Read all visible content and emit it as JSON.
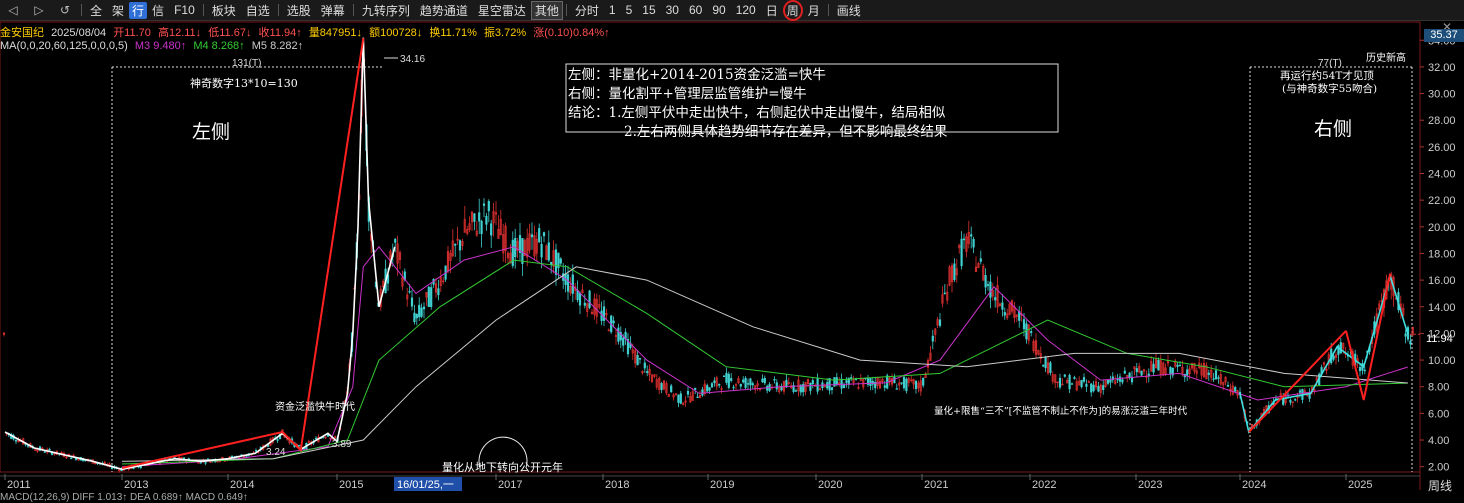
{
  "toolbar": {
    "items": [
      "全",
      "架",
      "行",
      "信",
      "F10",
      "板块",
      "自选",
      "选股",
      "弹幕",
      "九转序列",
      "趋势通道",
      "星空雷达",
      "其他",
      "分时",
      "1",
      "5",
      "15",
      "30",
      "60",
      "90",
      "120",
      "日",
      "周",
      "月",
      "画线"
    ]
  },
  "info": {
    "name": "金安国纪",
    "date": "2025/08/04",
    "open": "开11.70",
    "high": "高12.11↓",
    "low": "低11.67↓",
    "close": "收11.94↑",
    "vol": "量847951↓",
    "amount": "额100728↓",
    "turnover": "换11.71%",
    "amplitude": "振3.72%",
    "change": "涨(0.10)0.84%↑"
  },
  "ma": {
    "params": "MA(0,0,20,60,125,0,0,0,5)",
    "m3": "M3 9.480↑",
    "m4": "M4 8.268↑",
    "m5": "M5 8.282↑"
  },
  "badges": {
    "top": "35.37",
    "last": "11.94",
    "period": "周线"
  },
  "macd": "MACD(12,26,9)  DIFF 1.013↑  DEA 0.689↑  MACD 0.649↑",
  "annotations": {
    "box_line1": "左侧：非量化+2014-2015资金泛滥=快牛",
    "box_line2": "右侧：量化割平+管理层监管维护=慢牛",
    "box_line3": "结论：1.左侧平伏中走出快牛，右侧起伏中走出慢牛，结局相似",
    "box_line4": "2.左右两侧具体趋势细节存在差异，但不影响最终结果",
    "left_count": "131(T)",
    "left_magic": "神奇数字13*10=130",
    "left_label": "左侧",
    "right_count": "77(T)",
    "right_hist": "历史新高",
    "right_note1": "再运行约54T才见顶",
    "right_note2": "(与神奇数字55吻合)",
    "right_label": "右侧",
    "fund_note": "资金泛滥快牛时代",
    "quant_note": "量化从地下转向公开元年",
    "bottom_note": "量化+限售“三不”[不监管不制止不作为]的易涨泛滥三年时代",
    "cursor_date": "16/01/25,一",
    "peak": "34.16",
    "low1": "3.24",
    "low2": "3.89"
  },
  "chart_data": {
    "type": "candlestick",
    "title": "",
    "yticks": [
      2,
      4,
      6,
      8,
      10,
      12,
      14,
      16,
      18,
      20,
      22,
      24,
      26,
      28,
      30,
      32,
      34
    ],
    "ylim": [
      1.6,
      35.37
    ],
    "xticks": [
      "2011",
      "2013",
      "2014",
      "2015",
      "2017",
      "2018",
      "2019",
      "2020",
      "2021",
      "2022",
      "2023",
      "2024",
      "2025"
    ],
    "series": [
      {
        "name": "close",
        "points": [
          [
            "2011-01",
            4.6
          ],
          [
            "2011-07",
            3.4
          ],
          [
            "2012-01",
            2.9
          ],
          [
            "2012-07",
            2.4
          ],
          [
            "2013-01",
            1.8
          ],
          [
            "2013-04",
            2.2
          ],
          [
            "2013-07",
            2.6
          ],
          [
            "2013-10",
            2.4
          ],
          [
            "2014-01",
            2.6
          ],
          [
            "2014-04",
            3.0
          ],
          [
            "2014-07",
            4.5
          ],
          [
            "2014-09",
            3.3
          ],
          [
            "2014-12",
            4.5
          ],
          [
            "2015-01",
            3.9
          ],
          [
            "2015-03",
            7.5
          ],
          [
            "2015-04",
            12.0
          ],
          [
            "2015-05",
            20.0
          ],
          [
            "2015-06",
            34.2
          ],
          [
            "2015-07",
            22.0
          ],
          [
            "2015-09",
            14.0
          ],
          [
            "2015-12",
            18.5
          ],
          [
            "2016-03",
            13.0
          ],
          [
            "2016-06",
            16.0
          ],
          [
            "2016-09",
            19.5
          ],
          [
            "2016-12",
            21.0
          ],
          [
            "2017-03",
            18.0
          ],
          [
            "2017-06",
            19.0
          ],
          [
            "2017-09",
            16.0
          ],
          [
            "2017-12",
            14.0
          ],
          [
            "2018-03",
            12.0
          ],
          [
            "2018-06",
            9.0
          ],
          [
            "2018-10",
            7.0
          ],
          [
            "2019-03",
            8.5
          ],
          [
            "2019-09",
            8.0
          ],
          [
            "2020-03",
            8.2
          ],
          [
            "2020-09",
            8.4
          ],
          [
            "2021-01",
            8.0
          ],
          [
            "2021-04",
            16.0
          ],
          [
            "2021-06",
            19.0
          ],
          [
            "2021-09",
            15.0
          ],
          [
            "2021-12",
            13.0
          ],
          [
            "2022-04",
            8.5
          ],
          [
            "2022-09",
            8.0
          ],
          [
            "2023-03",
            9.5
          ],
          [
            "2023-09",
            9.2
          ],
          [
            "2024-01",
            7.5
          ],
          [
            "2024-02",
            4.6
          ],
          [
            "2024-05",
            7.0
          ],
          [
            "2024-09",
            7.5
          ],
          [
            "2024-12",
            11.0
          ],
          [
            "2025-03",
            9.5
          ],
          [
            "2025-06",
            16.3
          ],
          [
            "2025-08",
            11.94
          ]
        ]
      },
      {
        "name": "M3",
        "points": [
          [
            "2013-01",
            2.0
          ],
          [
            "2014-01",
            2.5
          ],
          [
            "2014-12",
            3.5
          ],
          [
            "2015-04",
            8.0
          ],
          [
            "2015-06",
            17.0
          ],
          [
            "2015-09",
            18.5
          ],
          [
            "2016-03",
            15.0
          ],
          [
            "2016-09",
            17.5
          ],
          [
            "2017-03",
            18.5
          ],
          [
            "2017-09",
            16.0
          ],
          [
            "2018-06",
            10.0
          ],
          [
            "2018-12",
            7.5
          ],
          [
            "2019-09",
            8.0
          ],
          [
            "2020-09",
            8.3
          ],
          [
            "2021-03",
            10.0
          ],
          [
            "2021-09",
            15.5
          ],
          [
            "2022-03",
            11.5
          ],
          [
            "2022-09",
            8.5
          ],
          [
            "2023-06",
            9.0
          ],
          [
            "2024-03",
            7.0
          ],
          [
            "2025-01",
            8.0
          ],
          [
            "2025-08",
            9.48
          ]
        ]
      },
      {
        "name": "M4",
        "points": [
          [
            "2013-01",
            2.2
          ],
          [
            "2014-06",
            2.6
          ],
          [
            "2015-03",
            4.0
          ],
          [
            "2015-09",
            10.0
          ],
          [
            "2016-06",
            14.0
          ],
          [
            "2017-03",
            17.5
          ],
          [
            "2017-09",
            17.0
          ],
          [
            "2018-06",
            13.5
          ],
          [
            "2019-03",
            9.5
          ],
          [
            "2020-03",
            8.5
          ],
          [
            "2021-03",
            9.0
          ],
          [
            "2021-09",
            11.0
          ],
          [
            "2022-03",
            13.0
          ],
          [
            "2022-12",
            10.5
          ],
          [
            "2023-09",
            9.5
          ],
          [
            "2024-06",
            8.0
          ],
          [
            "2025-08",
            8.268
          ]
        ]
      },
      {
        "name": "M5",
        "points": [
          [
            "2013-01",
            2.4
          ],
          [
            "2014-06",
            2.6
          ],
          [
            "2015-06",
            4.0
          ],
          [
            "2016-03",
            8.0
          ],
          [
            "2017-01",
            13.0
          ],
          [
            "2017-10",
            17.0
          ],
          [
            "2018-06",
            16.0
          ],
          [
            "2019-06",
            12.5
          ],
          [
            "2020-06",
            10.0
          ],
          [
            "2021-06",
            9.5
          ],
          [
            "2022-06",
            10.5
          ],
          [
            "2023-06",
            10.5
          ],
          [
            "2024-06",
            9.0
          ],
          [
            "2025-08",
            8.282
          ]
        ]
      }
    ],
    "colors": {
      "M3": "#cc33cc",
      "M4": "#33cc33",
      "M5": "#cccccc",
      "close": "#ffffff",
      "trend": "#ff2020",
      "trend2": "#40e0e0"
    },
    "trendlines": [
      [
        [
          "2013-01",
          1.9
        ],
        [
          "2014-07",
          4.6
        ],
        [
          "2014-09",
          3.24
        ],
        [
          "2015-06",
          34.16
        ]
      ],
      [
        [
          "2024-02",
          4.6
        ],
        [
          "2025-01",
          12.2
        ]
      ],
      [
        [
          "2025-01",
          12.2
        ],
        [
          "2025-03",
          7.0
        ],
        [
          "2025-06",
          16.5
        ]
      ]
    ]
  }
}
